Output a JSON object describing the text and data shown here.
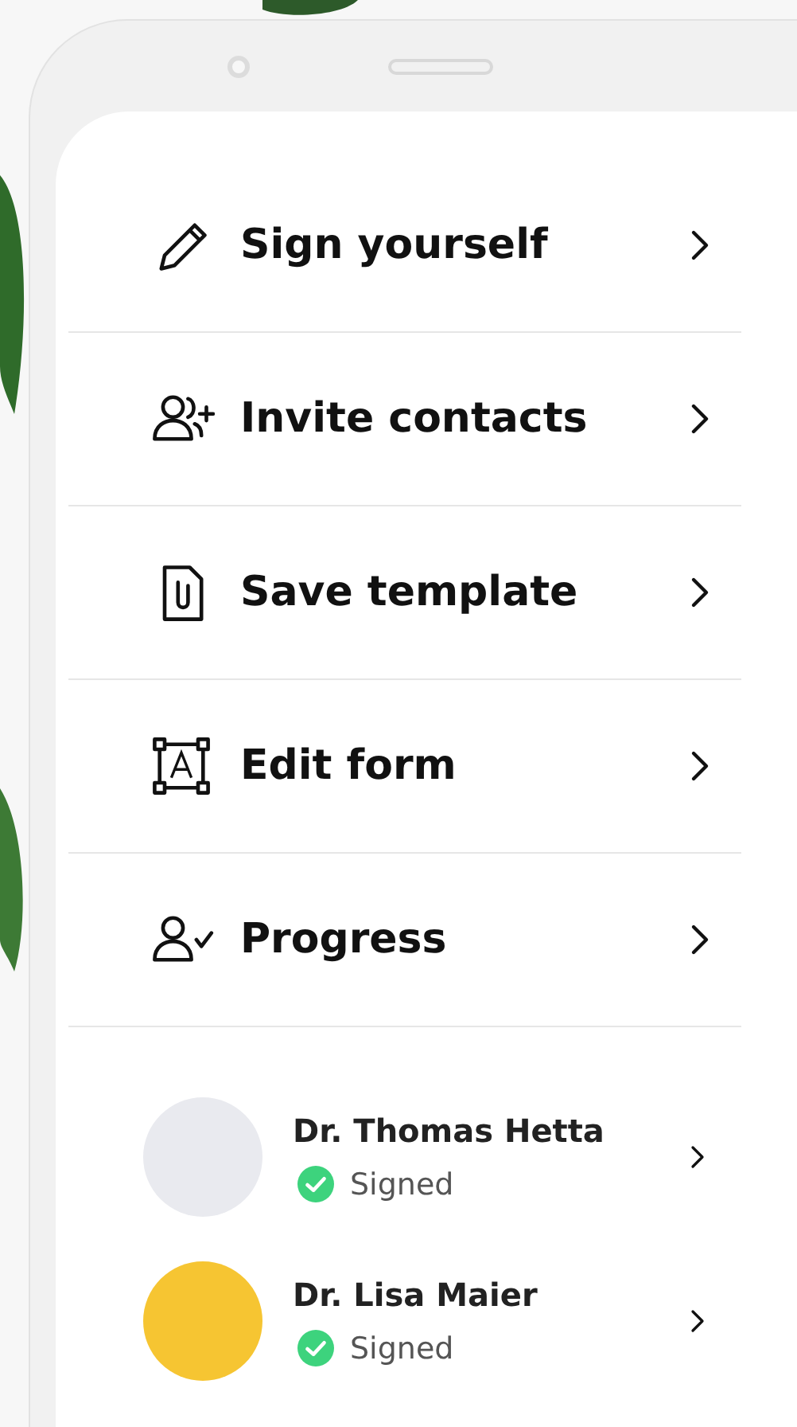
{
  "menu": [
    {
      "kind": "pencil",
      "label": "Sign yourself"
    },
    {
      "kind": "invite",
      "label": "Invite contacts"
    },
    {
      "kind": "template",
      "label": "Save template"
    },
    {
      "kind": "form",
      "label": "Edit form"
    },
    {
      "kind": "progress",
      "label": "Progress"
    }
  ],
  "signers": [
    {
      "name": "Dr. Thomas Hetta",
      "status": "Signed",
      "color": "#e9eaef"
    },
    {
      "name": "Dr. Lisa Maier",
      "status": "Signed",
      "color": "#f6c532"
    }
  ]
}
